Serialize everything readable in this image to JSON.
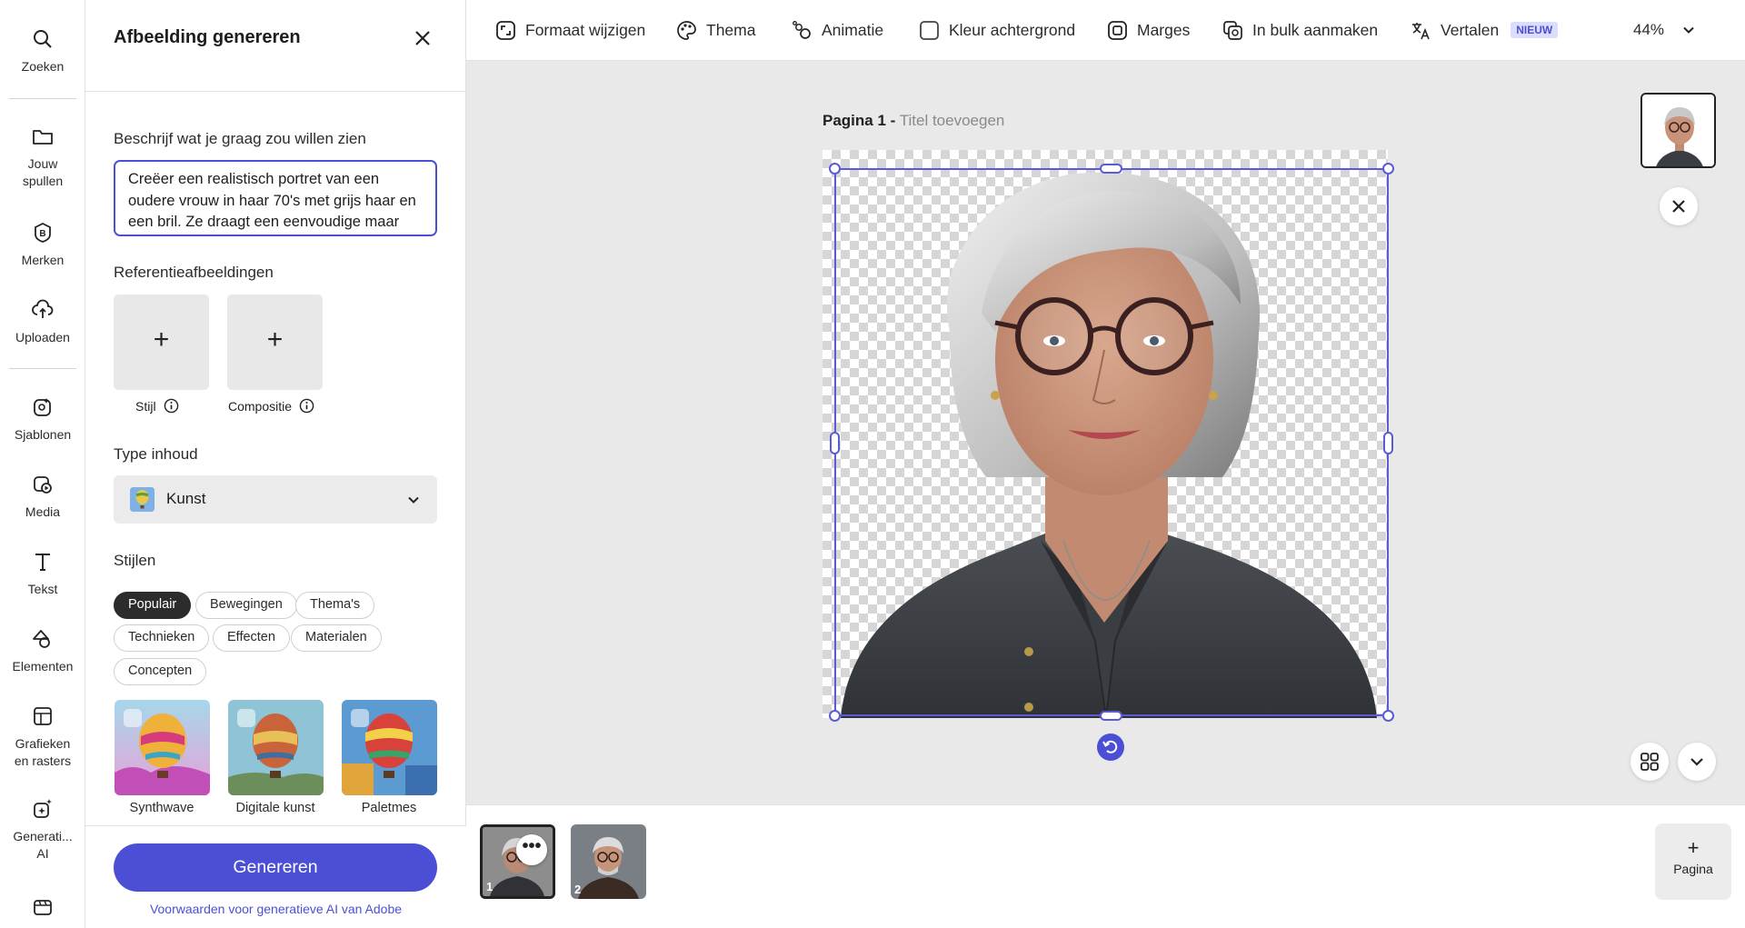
{
  "rail": {
    "items": [
      {
        "label": "Zoeken",
        "icon": "search-icon"
      },
      {
        "label": "Jouw spullen",
        "icon": "folder-icon"
      },
      {
        "label": "Merken",
        "icon": "brand-icon"
      },
      {
        "label": "Uploaden",
        "icon": "upload-icon"
      },
      {
        "label": "Sjablonen",
        "icon": "templates-icon"
      },
      {
        "label": "Media",
        "icon": "media-icon"
      },
      {
        "label": "Tekst",
        "icon": "text-icon"
      },
      {
        "label": "Elementen",
        "icon": "elements-icon"
      },
      {
        "label": "Grafieken en rasters",
        "icon": "grid-chart-icon"
      },
      {
        "label": "Generati... AI",
        "icon": "sparkle-icon"
      },
      {
        "label": "",
        "icon": "video-icon"
      }
    ]
  },
  "panel": {
    "title": "Afbeelding genereren",
    "prompt_label": "Beschrijf wat je graag zou willen zien",
    "prompt_value": "Creëer een realistisch portret van een oudere vrouw in haar 70's met grijs haar en een bril. Ze draagt een eenvoudige maar",
    "reference_label": "Referentieafbeeldingen",
    "reference_boxes": [
      {
        "label": "Stijl",
        "plus": "+"
      },
      {
        "label": "Compositie",
        "plus": "+"
      }
    ],
    "type_label": "Type inhoud",
    "type_value": "Kunst",
    "styles_label": "Stijlen",
    "style_chips": [
      "Populair",
      "Bewegingen",
      "Thema's",
      "Technieken",
      "Effecten",
      "Materialen",
      "Concepten"
    ],
    "active_chip": "Populair",
    "style_thumbs": [
      "Synthwave",
      "Digitale kunst",
      "Paletmes"
    ],
    "generate_label": "Genereren",
    "terms_link": "Voorwaarden voor generatieve AI van Adobe"
  },
  "toolbar": {
    "items": [
      {
        "label": "Formaat wijzigen",
        "icon": "resize-icon"
      },
      {
        "label": "Thema",
        "icon": "palette-icon"
      },
      {
        "label": "Animatie",
        "icon": "animation-icon"
      },
      {
        "label": "Kleur achtergrond",
        "icon": "checkbox-icon"
      },
      {
        "label": "Marges",
        "icon": "margins-icon"
      },
      {
        "label": "In bulk aanmaken",
        "icon": "bulk-create-icon"
      },
      {
        "label": "Vertalen",
        "icon": "translate-icon"
      }
    ],
    "translate_badge": "NIEUW",
    "zoom": "44%"
  },
  "canvas": {
    "page_label": "Pagina 1 -",
    "title_placeholder": "Titel toevoegen"
  },
  "pages": {
    "thumbs": [
      {
        "number": "1",
        "more": "•••"
      },
      {
        "number": "2"
      }
    ],
    "add_page_plus": "+",
    "add_page_label": "Pagina"
  },
  "colors": {
    "accent": "#4b4fd6",
    "selection": "#5b5bd6",
    "canvas_bg": "#e9e9e9",
    "badge_bg": "#dcdcfb"
  }
}
